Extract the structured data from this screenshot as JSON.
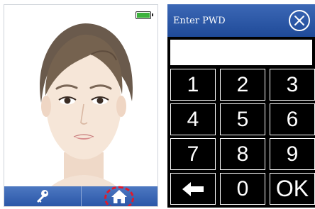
{
  "colors": {
    "title_bar": "#2b57a8",
    "keypad_bg": "#000000",
    "key_text": "#ffffff",
    "battery": "#3db23d",
    "home_highlight": "#e0192b"
  },
  "left_screen": {
    "battery_icon": "battery-full-icon",
    "image": "face-portrait",
    "bottom_bar": {
      "left_icon": "key-icon",
      "right_icon": "home-icon"
    }
  },
  "password_dialog": {
    "title": "Enter PWD",
    "close_icon": "close-icon",
    "input_value": "",
    "keys": [
      "1",
      "2",
      "3",
      "4",
      "5",
      "6",
      "7",
      "8",
      "9",
      "",
      "0",
      "OK"
    ],
    "back_key_icon": "arrow-left-icon"
  }
}
